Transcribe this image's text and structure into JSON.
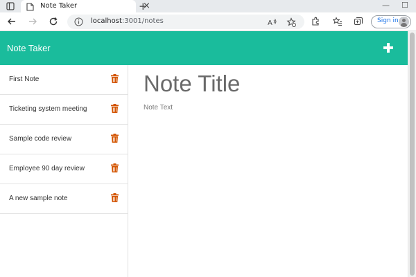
{
  "browser": {
    "tab_title": "Note Taker",
    "tab_close": "×",
    "new_tab": "+",
    "url_host": "localhost",
    "url_path": ":3001/notes",
    "signin_label": "Sign in",
    "minimize": "—",
    "maximize": "☐"
  },
  "app": {
    "title": "Note Taker",
    "accent_color": "#1abc9c",
    "trash_color": "#d35400"
  },
  "notes": [
    {
      "title": "First Note"
    },
    {
      "title": "Ticketing system meeting"
    },
    {
      "title": "Sample code review"
    },
    {
      "title": "Employee 90 day review"
    },
    {
      "title": "A new sample note"
    }
  ],
  "editor": {
    "title_placeholder": "Note Title",
    "text_placeholder": "Note Text"
  }
}
